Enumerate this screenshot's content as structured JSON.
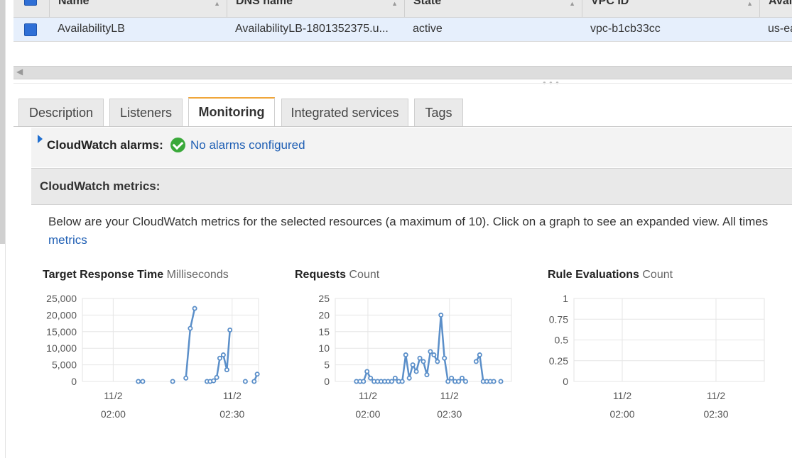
{
  "table": {
    "headers": [
      "Name",
      "DNS name",
      "State",
      "VPC ID",
      "Avai"
    ],
    "row": {
      "name": "AvailabilityLB",
      "dns": "AvailabilityLB-1801352375.u...",
      "state": "active",
      "vpc": "vpc-b1cb33cc",
      "az": "us-ea"
    }
  },
  "tabs": [
    "Description",
    "Listeners",
    "Monitoring",
    "Integrated services",
    "Tags"
  ],
  "active_tab": "Monitoring",
  "alarms": {
    "label": "CloudWatch alarms:",
    "link": "No alarms configured"
  },
  "metrics": {
    "title": "CloudWatch metrics:",
    "description": "Below are your CloudWatch metrics for the selected resources (a maximum of 10). Click on a graph to see an expanded view. All times",
    "link": "metrics"
  },
  "colors": {
    "line": "#5b8fc9",
    "accent_tab": "#f0a63a",
    "link": "#1f5fb4",
    "check": "#3aa93a"
  },
  "chart_data": [
    {
      "type": "line",
      "title": "Target Response Time",
      "unit": "Milliseconds",
      "ytick_labels": [
        "25,000",
        "20,000",
        "15,000",
        "10,000",
        "5,000",
        "0"
      ],
      "ylim": [
        0,
        25000
      ],
      "xtick_labels": [
        [
          "11/2",
          "02:00"
        ],
        [
          "11/2",
          "02:30"
        ]
      ],
      "xlim": [
        -7,
        33
      ],
      "grid": true,
      "series": [
        {
          "segments": [
            [
              [
                5.7,
                0
              ],
              [
                6.7,
                0
              ]
            ],
            [
              [
                13.5,
                0
              ]
            ],
            [
              [
                16.5,
                1000
              ],
              [
                17.5,
                16000
              ],
              [
                18.5,
                22000
              ]
            ],
            [
              [
                21.3,
                0
              ],
              [
                22.0,
                0
              ],
              [
                22.8,
                200
              ],
              [
                23.5,
                1200
              ],
              [
                24.2,
                7000
              ],
              [
                25.0,
                8000
              ],
              [
                25.8,
                3500
              ],
              [
                26.5,
                15500
              ]
            ],
            [
              [
                30.0,
                0
              ]
            ],
            [
              [
                32.0,
                0
              ],
              [
                32.7,
                2200
              ]
            ]
          ]
        }
      ]
    },
    {
      "type": "line",
      "title": "Requests",
      "unit": "Count",
      "ytick_labels": [
        "25",
        "20",
        "15",
        "10",
        "5",
        "0"
      ],
      "ylim": [
        0,
        25
      ],
      "xtick_labels": [
        [
          "11/2",
          "02:00"
        ],
        [
          "11/2",
          "02:30"
        ]
      ],
      "xlim": [
        -7,
        33
      ],
      "grid": true,
      "series": [
        {
          "segments": [
            [
              [
                4.0,
                0
              ],
              [
                5.0,
                0
              ],
              [
                6.0,
                0
              ],
              [
                7.0,
                3
              ],
              [
                8.0,
                1
              ],
              [
                9.0,
                0
              ],
              [
                10.0,
                0
              ],
              [
                11.0,
                0
              ],
              [
                12.0,
                0
              ],
              [
                13.0,
                0
              ],
              [
                14.0,
                0
              ],
              [
                15.0,
                1
              ],
              [
                16.0,
                0
              ],
              [
                17.0,
                0
              ],
              [
                18.0,
                8
              ],
              [
                19.0,
                1
              ],
              [
                20.0,
                5
              ],
              [
                21.0,
                3
              ],
              [
                22.0,
                7
              ],
              [
                23.0,
                6
              ],
              [
                24.0,
                2
              ],
              [
                25.0,
                9
              ],
              [
                26.0,
                8
              ],
              [
                27.0,
                6
              ],
              [
                28.0,
                20
              ],
              [
                29.0,
                7
              ],
              [
                30.0,
                0
              ],
              [
                31.0,
                1
              ],
              [
                32.0,
                0
              ],
              [
                33.0,
                0
              ],
              [
                34.0,
                1
              ],
              [
                35.0,
                0
              ]
            ],
            [
              [
                38.0,
                6
              ],
              [
                39.0,
                8
              ],
              [
                40.0,
                0
              ],
              [
                41.0,
                0
              ],
              [
                42.0,
                0
              ],
              [
                43.0,
                0
              ]
            ],
            [
              [
                45.0,
                0
              ]
            ]
          ]
        }
      ]
    },
    {
      "type": "line",
      "title": "Rule Evaluations",
      "unit": "Count",
      "ytick_labels": [
        "1",
        "0.75",
        "0.5",
        "0.25",
        "0"
      ],
      "ylim": [
        0,
        1
      ],
      "xtick_labels": [
        [
          "11/2",
          "02:00"
        ],
        [
          "11/2",
          "02:30"
        ]
      ],
      "xlim": [
        -7,
        33
      ],
      "grid": true,
      "series": []
    }
  ]
}
